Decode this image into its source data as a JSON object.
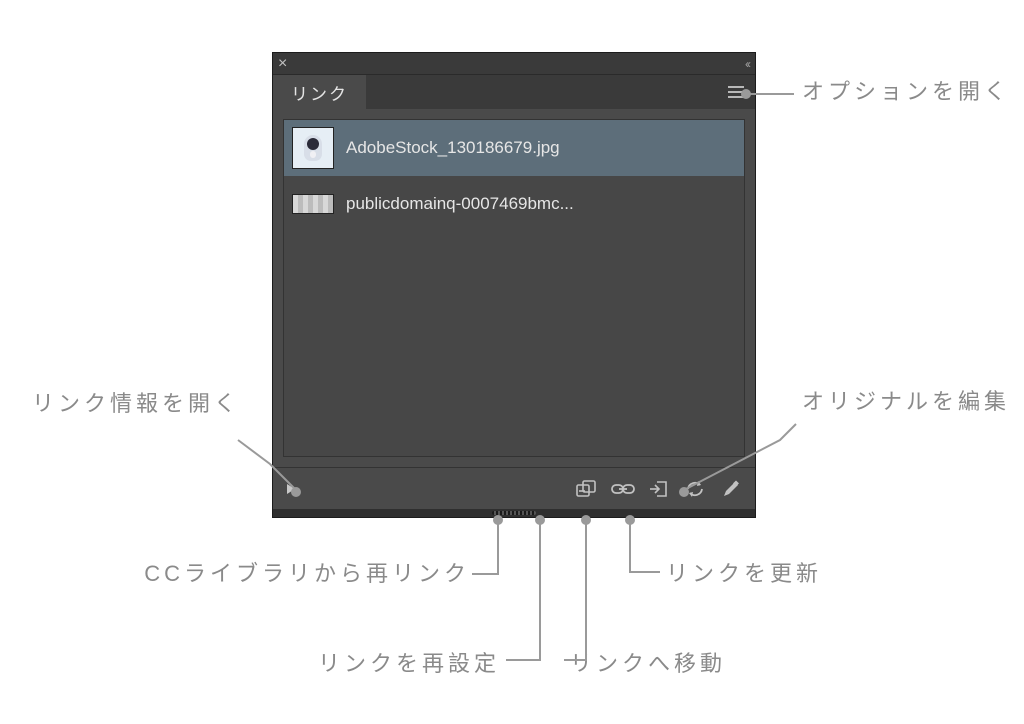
{
  "panel": {
    "tab_label": "リンク",
    "rows": [
      {
        "name": "AdobeStock_130186679.jpg",
        "selected": true,
        "thumb": "penguin"
      },
      {
        "name": "publicdomainq-0007469bmc...",
        "selected": false,
        "thumb": "strip"
      }
    ]
  },
  "icons": {
    "disclosure": "disclosure-triangle",
    "cc_relink": "cc-relink-icon",
    "relink": "chain-link-icon",
    "goto": "goto-link-icon",
    "update": "refresh-icon",
    "edit": "pencil-icon",
    "menu": "hamburger-menu-icon",
    "close": "close-icon",
    "collapse": "collapse-icon"
  },
  "annotations": {
    "open_options": "オプションを開く",
    "open_link_info": "リンク情報を開く",
    "edit_original": "オリジナルを編集",
    "cc_relink": "CCライブラリから再リンク",
    "relink": "リンクを再設定",
    "goto": "リンクへ移動",
    "update": "リンクを更新"
  },
  "colors": {
    "panel_bg": "#4a4a4a",
    "selected_row": "#5d6e7a",
    "label_text": "#8a8a8a"
  }
}
